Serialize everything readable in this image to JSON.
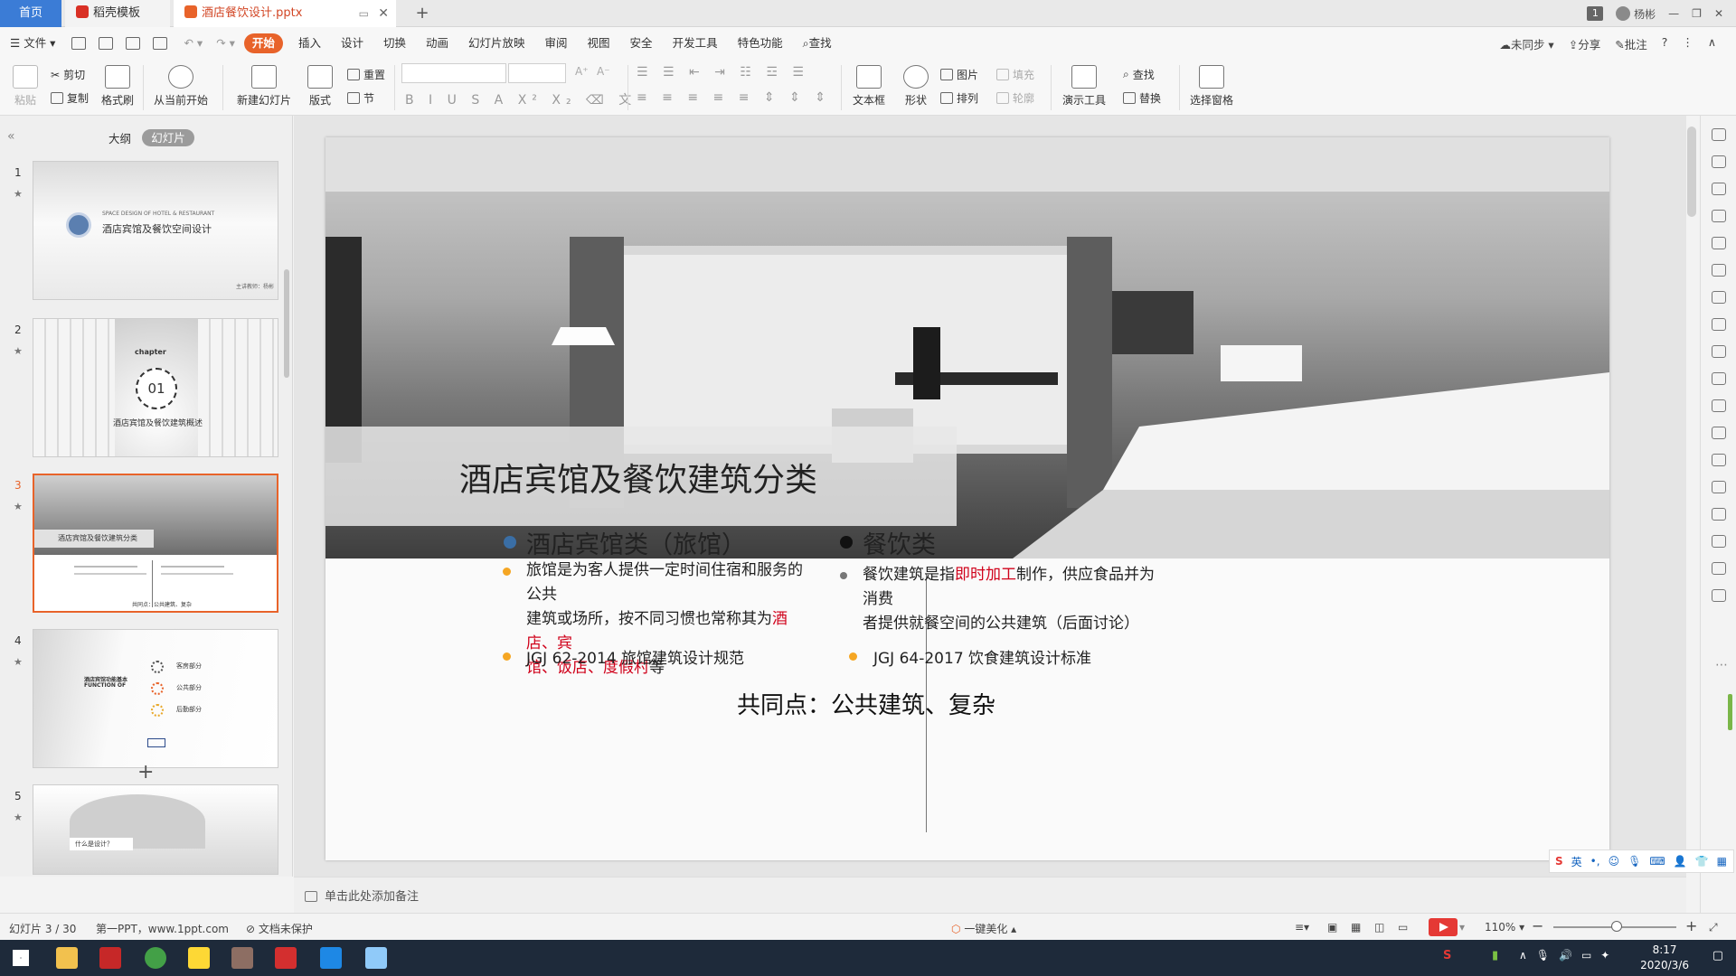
{
  "tabs": {
    "home": "首页",
    "docer": "稻壳模板",
    "document": "酒店餐饮设计.pptx",
    "new_tab": "+"
  },
  "title_bar": {
    "badge": "1",
    "user": "杨彬"
  },
  "menu": {
    "file": "文件",
    "items": [
      "开始",
      "插入",
      "设计",
      "切换",
      "动画",
      "幻灯片放映",
      "审阅",
      "视图",
      "安全",
      "开发工具",
      "特色功能"
    ],
    "search": "查找",
    "sync": "未同步",
    "share": "分享",
    "comment": "批注",
    "help": "?"
  },
  "ribbon": {
    "paste": "粘贴",
    "cut": "剪切",
    "copy": "复制",
    "format_painter": "格式刷",
    "play_from_current": "从当前开始",
    "new_slide": "新建幻灯片",
    "layout": "版式",
    "reset": "重置",
    "section": "节",
    "font_size_up": "A⁺",
    "font_size_down": "A⁻",
    "textbox": "文本框",
    "shape": "形状",
    "picture": "图片",
    "fill": "填充",
    "arrange": "排列",
    "outline": "轮廓",
    "presenter_tools": "演示工具",
    "find": "查找",
    "replace": "替换",
    "selection_pane": "选择窗格"
  },
  "left_pane": {
    "tab_outline": "大纲",
    "tab_slides": "幻灯片",
    "add_slide": "+",
    "thumbnails": [
      {
        "num": "1",
        "label": "酒店宾馆及餐饮空间设计",
        "sublabel": "SPACE DESIGN OF HOTEL & RESTAURANT",
        "footer": "主讲教师：杨彬"
      },
      {
        "num": "2",
        "label": "酒店宾馆及餐饮建筑概述",
        "sublabel": "chapter",
        "badge": "01"
      },
      {
        "num": "3",
        "label": "酒店宾馆及餐饮建筑分类",
        "sublabel": "共同点：公共建筑、复杂"
      },
      {
        "num": "4",
        "label": "酒店宾馆功能基本",
        "sublabel": "FUNCTION OF",
        "items": [
          "客房部分",
          "公共部分",
          "后勤部分"
        ]
      },
      {
        "num": "5",
        "label": "什么是设计？"
      }
    ]
  },
  "slide": {
    "title": "酒店宾馆及餐饮建筑分类",
    "left_heading": "酒店宾馆类（旅馆）",
    "left_text_1": "旅馆是为客人提供一定时间住宿和服务的公共",
    "left_text_2": "建筑或场所，按不同习惯也常称其为",
    "left_text_red_1": "酒店、宾",
    "left_text_red_2": "馆、饭店、度假村",
    "left_text_end": "等",
    "left_standard": "JGJ 62-2014 旅馆建筑设计规范",
    "right_heading": "餐饮类",
    "right_text_1": "餐饮建筑是指",
    "right_text_red": "即时加工",
    "right_text_2": "制作，供应食品并为消费",
    "right_text_3": "者提供就餐空间的公共建筑（后面讨论）",
    "right_standard": "JGJ 64-2017 饮食建筑设计标准",
    "common": "共同点：公共建筑、复杂"
  },
  "notes": {
    "placeholder": "单击此处添加备注"
  },
  "status": {
    "slide_count": "幻灯片 3 / 30",
    "theme": "第一PPT，www.1ppt.com",
    "protection": "文档未保护",
    "beautify": "一键美化",
    "zoom": "110%"
  },
  "ime": {
    "label": "英"
  },
  "taskbar": {
    "time": "8:17",
    "date": "2020/3/6"
  },
  "colors": {
    "accent": "#e8632a",
    "home_tab": "#3b7cd6",
    "bullet_blue": "#3a6ea5",
    "bullet_orange": "#f5a623",
    "bullet_black": "#111111",
    "bullet_grey": "#777777",
    "red_text": "#d0021b"
  }
}
